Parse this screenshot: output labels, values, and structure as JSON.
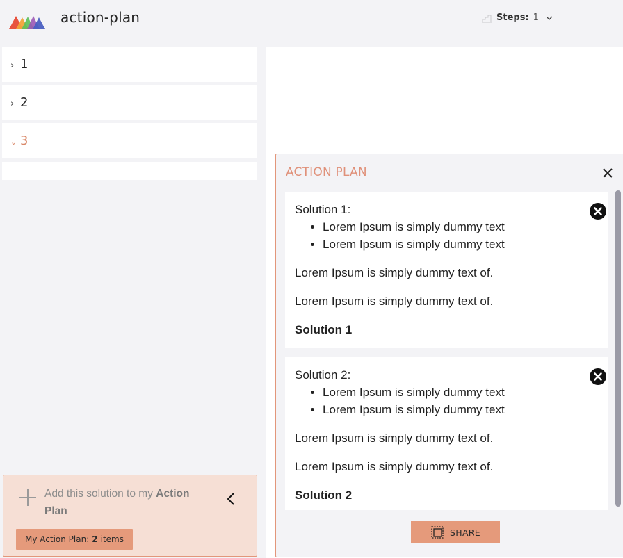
{
  "header": {
    "app_title": "action-plan",
    "steps_label": "Steps:",
    "steps_value": "1",
    "logo_colors": [
      "#e8533f",
      "#f2a33a",
      "#5bbf5a",
      "#4a5fc1",
      "#9b59b6"
    ]
  },
  "steps_list": [
    {
      "label": "1",
      "expanded": false
    },
    {
      "label": "2",
      "expanded": false
    },
    {
      "label": "3",
      "expanded": true
    }
  ],
  "add_box": {
    "text_prefix": "Add this solution to my",
    "text_bold": "Action Plan",
    "plan_prefix": "My Action Plan:",
    "plan_count": "2",
    "plan_suffix": "items"
  },
  "action_plan": {
    "title": "ACTION PLAN",
    "share_label": "SHARE",
    "solutions": [
      {
        "heading": "Solution 1:",
        "bullets": [
          "Lorem Ipsum is simply dummy text",
          "Lorem Ipsum is simply dummy text"
        ],
        "paragraphs": [
          "Lorem Ipsum is simply dummy text of.",
          "Lorem Ipsum is simply dummy text of."
        ],
        "title": "Solution 1"
      },
      {
        "heading": "Solution 2:",
        "bullets": [
          "Lorem Ipsum is simply dummy text",
          "Lorem Ipsum is simply dummy text"
        ],
        "paragraphs": [
          "Lorem Ipsum is simply dummy text of.",
          "Lorem Ipsum is simply dummy text of."
        ],
        "title": "Solution 2"
      }
    ]
  },
  "colors": {
    "accent": "#e59a7b",
    "accent_text": "#e0917a",
    "add_box_bg": "#f6dfd5",
    "page_bg": "#f3f3f6"
  },
  "icons": {
    "logo": "mountains-logo",
    "steps": "chart-steps-icon",
    "steps_dropdown": "chevron-down-icon",
    "step_collapsed": "chevron-right-icon",
    "step_expanded": "chevron-down-icon",
    "add": "plus-icon",
    "collapse": "chevron-left-icon",
    "close": "close-icon",
    "remove": "remove-circle-icon",
    "share": "share-icon"
  }
}
